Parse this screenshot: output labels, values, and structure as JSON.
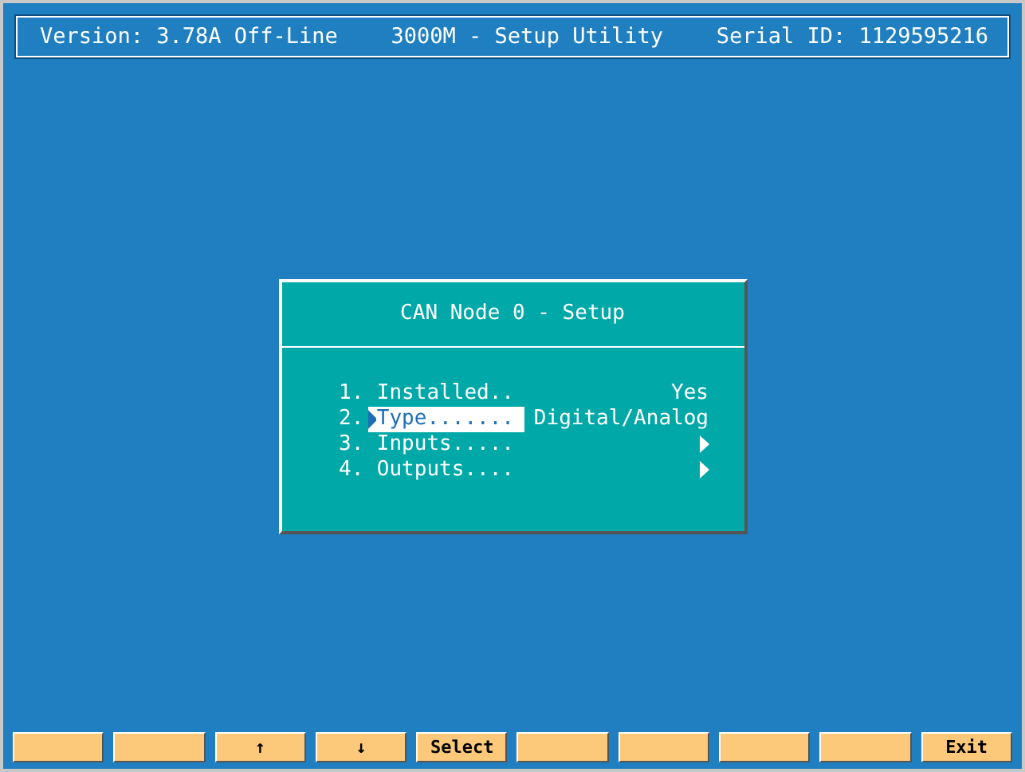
{
  "header": {
    "version": "Version: 3.78A Off-Line",
    "title": "3000M - Setup Utility",
    "serial": "Serial ID: 1129595216"
  },
  "dialog": {
    "title": "CAN Node 0 - Setup",
    "items": [
      {
        "number": "1.",
        "label": "Installed..",
        "kind": "text",
        "value": "Yes",
        "selected": false
      },
      {
        "number": "2.",
        "label": "Type.......",
        "kind": "text",
        "value": "Digital/Analog",
        "selected": true
      },
      {
        "number": "3.",
        "label": "Inputs.....",
        "kind": "arrow",
        "selected": false
      },
      {
        "number": "4.",
        "label": "Outputs....",
        "kind": "arrow",
        "selected": false
      }
    ]
  },
  "function_keys": [
    {
      "kind": "blank"
    },
    {
      "kind": "blank"
    },
    {
      "kind": "labeled",
      "label": "↑"
    },
    {
      "kind": "labeled",
      "label": "↓"
    },
    {
      "kind": "labeled",
      "label": "Select"
    },
    {
      "kind": "blank"
    },
    {
      "kind": "blank"
    },
    {
      "kind": "blank"
    },
    {
      "kind": "blank"
    },
    {
      "kind": "labeled",
      "label": "Exit"
    }
  ]
}
